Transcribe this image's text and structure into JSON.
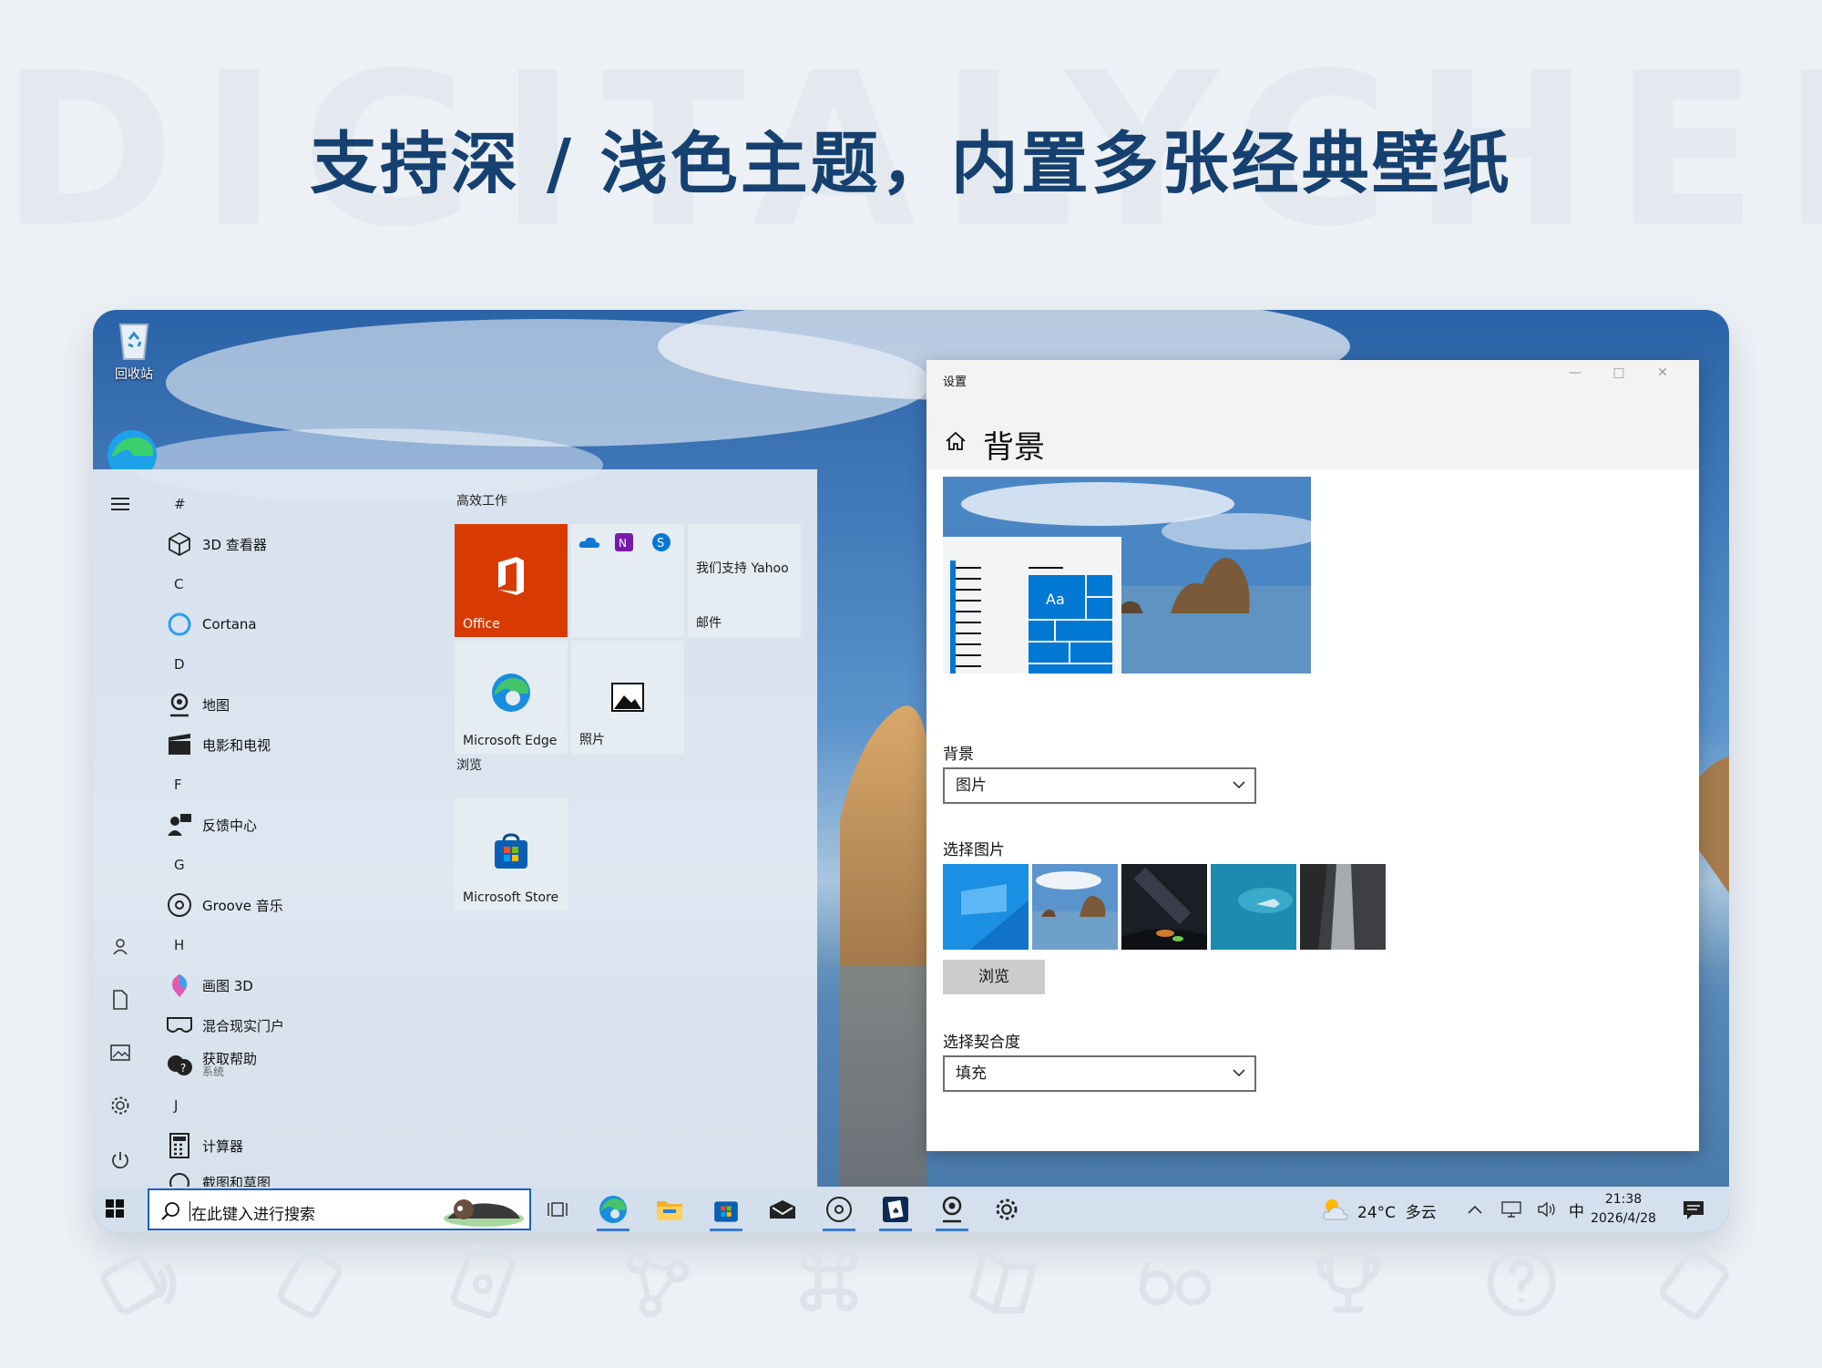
{
  "banner": {
    "watermark": "DIGITALYCHEE",
    "headline": "支持深 / 浅色主题，内置多张经典壁纸"
  },
  "desktop": {
    "recycle_bin_label": "回收站"
  },
  "start_menu": {
    "letters": {
      "hash": "#",
      "c": "C",
      "d": "D",
      "f": "F",
      "g": "G",
      "h": "H",
      "j": "J"
    },
    "apps": {
      "viewer3d": "3D 查看器",
      "cortana": "Cortana",
      "maps": "地图",
      "movies": "电影和电视",
      "feedback": "反馈中心",
      "groove": "Groove 音乐",
      "paint3d": "画图 3D",
      "mixed_reality": "混合现实门户",
      "get_help": "获取帮助",
      "get_help_sub": "系统",
      "calculator": "计算器",
      "snip": "截图和草图"
    },
    "groups": {
      "productivity": "高效工作",
      "browse": "浏览"
    },
    "tiles": {
      "office": "Office",
      "yahoo": "我们支持 Yahoo",
      "mail": "邮件",
      "edge": "Microsoft Edge",
      "photos": "照片",
      "store": "Microsoft Store"
    }
  },
  "settings": {
    "window_title": "设置",
    "page_title": "背景",
    "background_label": "背景",
    "background_value": "图片",
    "choose_picture_label": "选择图片",
    "browse_button": "浏览",
    "fit_label": "选择契合度",
    "fit_value": "填充",
    "preview_sample_text": "Aa"
  },
  "taskbar": {
    "search_placeholder": "在此键入进行搜索",
    "weather": "24°C  多云",
    "ime": "中",
    "time": "21:38",
    "date": "2026/4/28"
  },
  "colors": {
    "accent": "#0078d4",
    "office_tile": "#d83b01",
    "headline": "#16406f"
  },
  "icons": [
    "recycle-bin-icon",
    "edge-icon",
    "hamburger-icon",
    "user-icon",
    "document-icon",
    "pictures-icon",
    "gear-icon",
    "power-icon",
    "cube-icon",
    "cortana-icon",
    "maps-icon",
    "movies-icon",
    "feedback-icon",
    "groove-icon",
    "paint3d-icon",
    "mixed-reality-icon",
    "help-icon",
    "calculator-icon",
    "snip-icon",
    "office-icon",
    "onedrive-icon",
    "onenote-icon",
    "skype-icon",
    "photos-icon",
    "store-icon",
    "home-icon",
    "chevron-down-icon",
    "windows-logo-icon",
    "search-icon",
    "task-view-icon",
    "file-explorer-icon",
    "mail-icon",
    "weather-icon",
    "tray-up-icon",
    "network-icon",
    "volume-icon",
    "notification-icon"
  ]
}
